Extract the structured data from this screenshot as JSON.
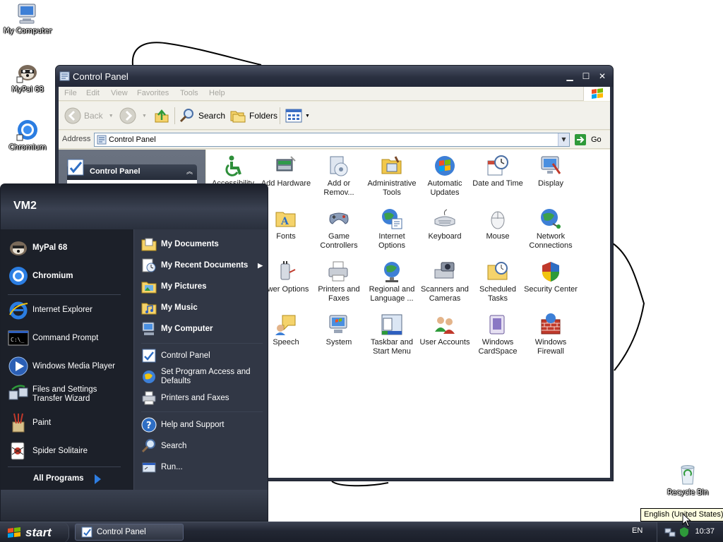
{
  "desktop": {
    "icons": [
      {
        "label": "My Computer",
        "icon": "my-computer-icon"
      },
      {
        "label": "MyPal 68",
        "icon": "mypal-icon"
      },
      {
        "label": "Chromium",
        "icon": "chromium-icon"
      },
      {
        "label": "Recycle Bin",
        "icon": "recycle-bin-icon"
      }
    ]
  },
  "window": {
    "title": "Control Panel",
    "menu": [
      "File",
      "Edit",
      "View",
      "Favorites",
      "Tools",
      "Help"
    ],
    "toolbar": {
      "back": "Back",
      "search": "Search",
      "folders": "Folders"
    },
    "address": {
      "label": "Address",
      "value": "Control Panel",
      "go": "Go"
    },
    "tasks_box": {
      "title": "Control Panel"
    },
    "items": [
      {
        "label": "Accessibility",
        "icon": "accessibility-icon"
      },
      {
        "label": "Add Hardware",
        "icon": "add-hardware-icon"
      },
      {
        "label": "Add or Remov...",
        "icon": "add-remove-programs-icon"
      },
      {
        "label": "Administrative Tools",
        "icon": "administrative-tools-icon"
      },
      {
        "label": "Automatic Updates",
        "icon": "automatic-updates-icon"
      },
      {
        "label": "Date and Time",
        "icon": "date-time-icon"
      },
      {
        "label": "Display",
        "icon": "display-icon"
      },
      {
        "label": "Fonts",
        "icon": "fonts-icon"
      },
      {
        "label": "Game Controllers",
        "icon": "game-controllers-icon"
      },
      {
        "label": "Internet Options",
        "icon": "internet-options-icon"
      },
      {
        "label": "Keyboard",
        "icon": "keyboard-icon"
      },
      {
        "label": "Mouse",
        "icon": "mouse-icon"
      },
      {
        "label": "Network Connections",
        "icon": "network-connections-icon"
      },
      {
        "label": "ower Options",
        "icon": "power-options-icon"
      },
      {
        "label": "Printers and Faxes",
        "icon": "printers-faxes-icon"
      },
      {
        "label": "Regional and Language ...",
        "icon": "regional-language-icon"
      },
      {
        "label": "Scanners and Cameras",
        "icon": "scanners-cameras-icon"
      },
      {
        "label": "Scheduled Tasks",
        "icon": "scheduled-tasks-icon"
      },
      {
        "label": "Security Center",
        "icon": "security-center-icon"
      },
      {
        "label": "Speech",
        "icon": "speech-icon"
      },
      {
        "label": "System",
        "icon": "system-icon"
      },
      {
        "label": "Taskbar and Start Menu",
        "icon": "taskbar-start-menu-icon"
      },
      {
        "label": "User Accounts",
        "icon": "user-accounts-icon"
      },
      {
        "label": "Windows CardSpace",
        "icon": "cardspace-icon"
      },
      {
        "label": "Windows Firewall",
        "icon": "firewall-icon"
      }
    ]
  },
  "start_menu": {
    "user": "VM2",
    "pinned": [
      "MyPal 68",
      "Chromium"
    ],
    "recent": [
      "Internet Explorer",
      "Command Prompt",
      "Windows Media Player",
      "Files and Settings Transfer Wizard",
      "Paint",
      "Spider Solitaire"
    ],
    "all_programs": "All Programs",
    "places": [
      "My Documents",
      "My Recent Documents",
      "My Pictures",
      "My Music",
      "My Computer"
    ],
    "settings": [
      "Control Panel",
      "Set Program Access and Defaults",
      "Printers and Faxes"
    ],
    "help": [
      "Help and Support",
      "Search",
      "Run..."
    ]
  },
  "taskbar": {
    "start": "start",
    "task": "Control Panel",
    "language": "EN",
    "clock": "10:37",
    "tooltip": "English (United States)"
  },
  "colors": {
    "accent": "#2b3140",
    "panel": "#ece9d8",
    "tooltip": "#ffffe1"
  }
}
